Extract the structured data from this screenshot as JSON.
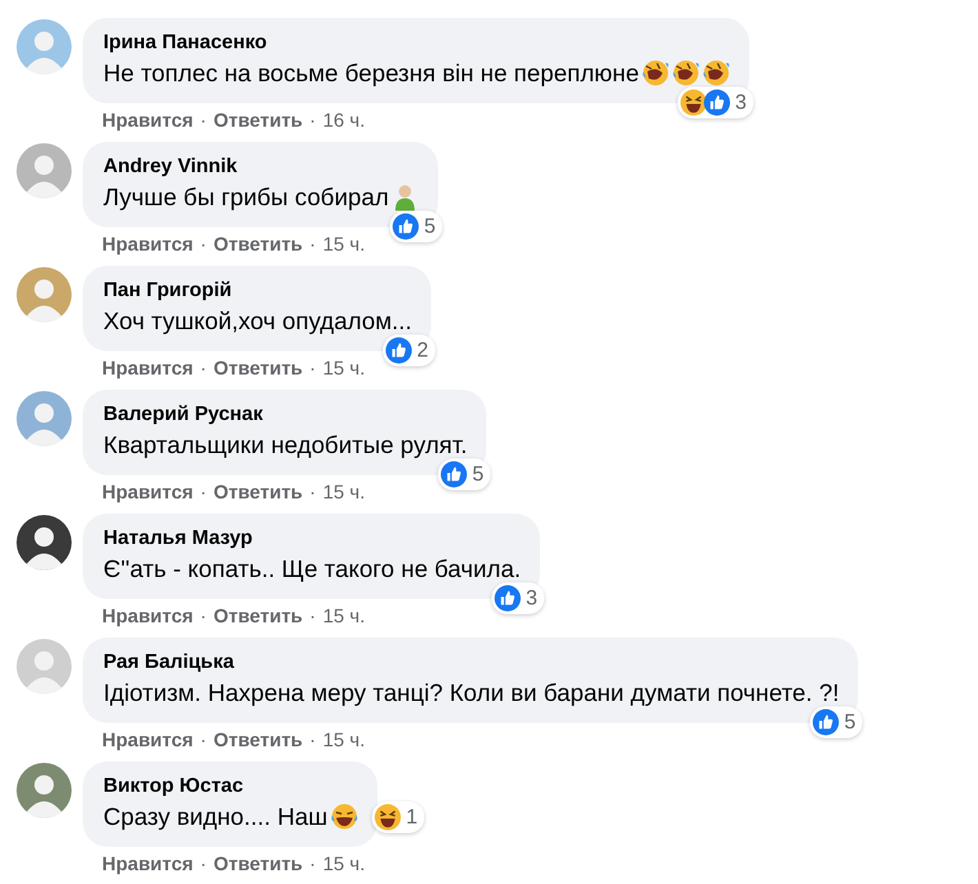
{
  "comments": [
    {
      "author": "Ірина Панасенко",
      "text": "Не топлес на восьме березня він не переплюне",
      "text_emojis": [
        {
          "kind": "rofl"
        },
        {
          "kind": "rofl"
        },
        {
          "kind": "rofl"
        }
      ],
      "reaction_badge": {
        "kind": "corner",
        "icons": [
          {
            "kind": "haha"
          },
          {
            "kind": "like"
          }
        ],
        "count": "3"
      },
      "actions": [
        {
          "kind": "link",
          "text": "Нравится"
        },
        {
          "kind": "dot",
          "text": "·"
        },
        {
          "kind": "link",
          "text": "Ответить"
        },
        {
          "kind": "dot",
          "text": "·"
        },
        {
          "kind": "time",
          "text": "16 ч."
        }
      ]
    },
    {
      "author": "Andrey Vinnik",
      "text": "Лучше бы грибы собирал",
      "text_emojis": [
        {
          "kind": "person"
        }
      ],
      "reaction_badge": {
        "kind": "corner",
        "icons": [
          {
            "kind": "like"
          }
        ],
        "count": "5"
      },
      "actions": [
        {
          "kind": "link",
          "text": "Нравится"
        },
        {
          "kind": "dot",
          "text": "·"
        },
        {
          "kind": "link",
          "text": "Ответить"
        },
        {
          "kind": "dot",
          "text": "·"
        },
        {
          "kind": "time",
          "text": "15 ч."
        }
      ]
    },
    {
      "author": "Пан Григорій",
      "text": "Хоч тушкой,хоч опудалом...",
      "reaction_badge": {
        "kind": "corner",
        "icons": [
          {
            "kind": "like"
          }
        ],
        "count": "2"
      },
      "actions": [
        {
          "kind": "link",
          "text": "Нравится"
        },
        {
          "kind": "dot",
          "text": "·"
        },
        {
          "kind": "link",
          "text": "Ответить"
        },
        {
          "kind": "dot",
          "text": "·"
        },
        {
          "kind": "time",
          "text": "15 ч."
        }
      ]
    },
    {
      "author": "Валерий Руснак",
      "text": "Квартальщики недобитые рулят.",
      "reaction_badge": {
        "kind": "corner",
        "icons": [
          {
            "kind": "like"
          }
        ],
        "count": "5"
      },
      "actions": [
        {
          "kind": "link",
          "text": "Нравится"
        },
        {
          "kind": "dot",
          "text": "·"
        },
        {
          "kind": "link",
          "text": "Ответить"
        },
        {
          "kind": "dot",
          "text": "·"
        },
        {
          "kind": "time",
          "text": "15 ч."
        }
      ]
    },
    {
      "author": "Наталья Мазур",
      "text": "Є''ать - копать.. Ще такого не бачила.",
      "reaction_badge": {
        "kind": "corner",
        "icons": [
          {
            "kind": "like"
          }
        ],
        "count": "3"
      },
      "actions": [
        {
          "kind": "link",
          "text": "Нравится"
        },
        {
          "kind": "dot",
          "text": "·"
        },
        {
          "kind": "link",
          "text": "Ответить"
        },
        {
          "kind": "dot",
          "text": "·"
        },
        {
          "kind": "time",
          "text": "15 ч."
        }
      ]
    },
    {
      "author": "Рая Баліцька",
      "text": "Ідіотизм. Нахрена меру танці? Коли ви барани думати почнете. ?!",
      "reaction_badge": {
        "kind": "corner",
        "icons": [
          {
            "kind": "like"
          }
        ],
        "count": "5"
      },
      "actions": [
        {
          "kind": "link",
          "text": "Нравится"
        },
        {
          "kind": "dot",
          "text": "·"
        },
        {
          "kind": "link",
          "text": "Ответить"
        },
        {
          "kind": "dot",
          "text": "·"
        },
        {
          "kind": "time",
          "text": "15 ч."
        }
      ]
    },
    {
      "author": "Виктор Юстас",
      "text": "Сразу видно.... Наш",
      "text_emojis": [
        {
          "kind": "joy"
        }
      ],
      "reaction_badge": {
        "kind": "beside",
        "icons": [
          {
            "kind": "haha"
          }
        ],
        "count": "1"
      },
      "actions": [
        {
          "kind": "link",
          "text": "Нравится"
        },
        {
          "kind": "dot",
          "text": "·"
        },
        {
          "kind": "link",
          "text": "Ответить"
        },
        {
          "kind": "dot",
          "text": "·"
        },
        {
          "kind": "time",
          "text": "15 ч."
        }
      ]
    }
  ]
}
